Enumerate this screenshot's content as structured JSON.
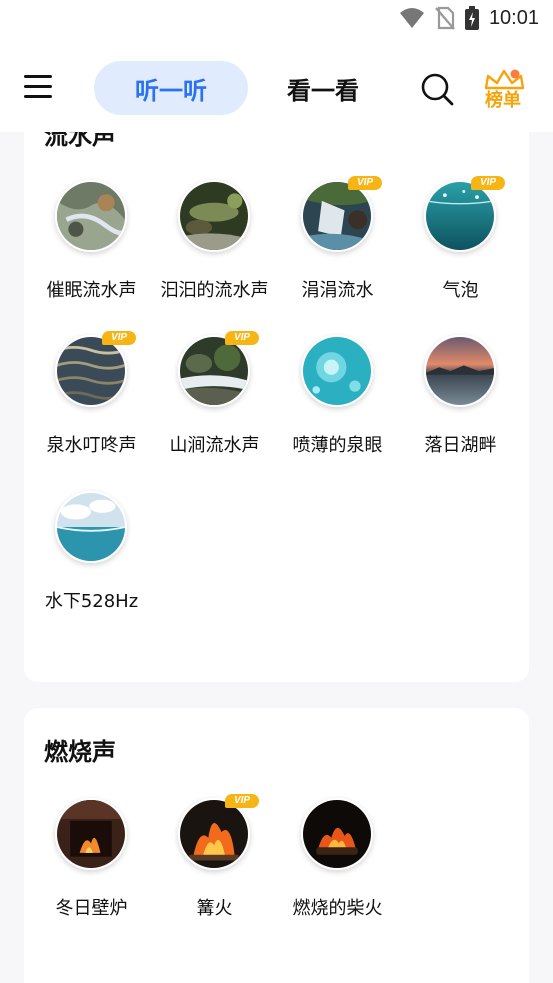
{
  "status_bar": {
    "time": "10:01"
  },
  "header": {
    "tab_listen": "听一听",
    "tab_watch": "看一看",
    "rank_label": "榜单"
  },
  "sections": [
    {
      "title": "流水声",
      "items": [
        {
          "label": "催眠流水声",
          "vip": false,
          "icon": "stream-rocks-thumbnail"
        },
        {
          "label": "汩汩的流水声",
          "vip": false,
          "icon": "mossy-stream-thumbnail"
        },
        {
          "label": "涓涓流水",
          "vip": true,
          "icon": "waterfall-thumbnail"
        },
        {
          "label": "气泡",
          "vip": true,
          "icon": "underwater-bubbles-thumbnail"
        },
        {
          "label": "泉水叮咚声",
          "vip": true,
          "icon": "water-ripples-thumbnail"
        },
        {
          "label": "山涧流水声",
          "vip": true,
          "icon": "mountain-stream-thumbnail"
        },
        {
          "label": "喷薄的泉眼",
          "vip": false,
          "icon": "spring-water-thumbnail"
        },
        {
          "label": "落日湖畔",
          "vip": false,
          "icon": "sunset-lake-thumbnail"
        },
        {
          "label": "水下528Hz",
          "vip": false,
          "icon": "ocean-surface-thumbnail"
        }
      ]
    },
    {
      "title": "燃烧声",
      "items": [
        {
          "label": "冬日壁炉",
          "vip": false,
          "icon": "fireplace-thumbnail"
        },
        {
          "label": "篝火",
          "vip": true,
          "icon": "bonfire-thumbnail"
        },
        {
          "label": "燃烧的柴火",
          "vip": false,
          "icon": "burning-wood-thumbnail"
        }
      ]
    }
  ],
  "vip_badge": "VIP"
}
